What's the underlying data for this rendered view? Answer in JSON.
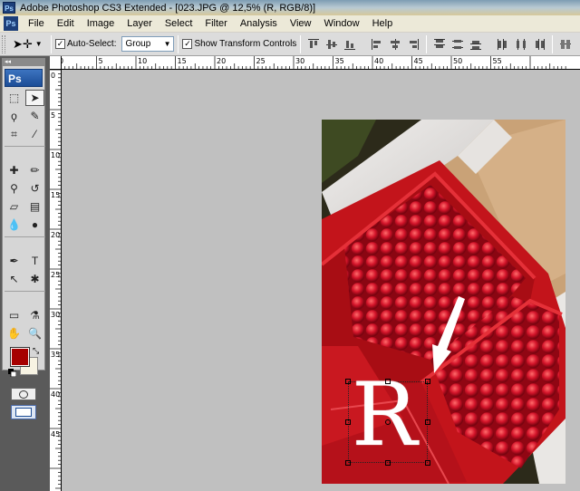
{
  "window": {
    "title": "Adobe Photoshop CS3 Extended - [023.JPG @ 12,5% (R, RGB/8)]",
    "logo_text": "Ps"
  },
  "menu": {
    "logo_text": "Ps",
    "items": [
      {
        "label": "File"
      },
      {
        "label": "Edit"
      },
      {
        "label": "Image"
      },
      {
        "label": "Layer"
      },
      {
        "label": "Select"
      },
      {
        "label": "Filter"
      },
      {
        "label": "Analysis"
      },
      {
        "label": "View"
      },
      {
        "label": "Window"
      },
      {
        "label": "Help"
      }
    ]
  },
  "options": {
    "auto_select_label": "Auto-Select:",
    "auto_select_checked": true,
    "auto_select_mode": "Group",
    "show_transform_label": "Show Transform Controls",
    "show_transform_checked": true
  },
  "toolbox": {
    "header": "Ps",
    "grip": "◂◂",
    "foreground_color": "#a60000",
    "background_color": "#f7f3e3"
  },
  "rulers": {
    "horizontal_labels": [
      "5",
      "0",
      "5",
      "10",
      "15",
      "20",
      "25",
      "30",
      "35",
      "40",
      "45",
      "50",
      "55"
    ],
    "vertical_labels": [
      "0",
      "5",
      "10",
      "15",
      "20",
      "25",
      "30",
      "35",
      "40",
      "45"
    ]
  },
  "document": {
    "layer_text": "R",
    "zoom": "12,5%",
    "file_name": "023.JPG",
    "color_mode": "RGB/8"
  }
}
